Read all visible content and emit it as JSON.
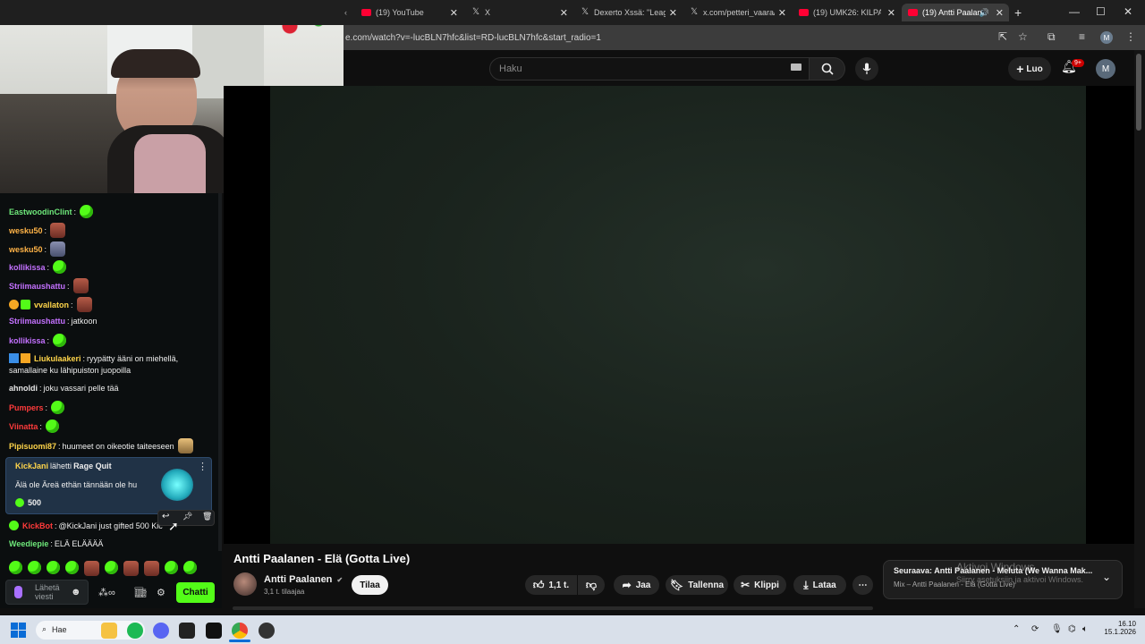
{
  "browser": {
    "tabs": [
      {
        "label": "(19) YouTube",
        "icon": "youtube-icon"
      },
      {
        "label": "X",
        "icon": "x-icon"
      },
      {
        "label": "Dexerto Xssä: \"Leagu",
        "icon": "x-icon"
      },
      {
        "label": "x.com/petteri_vaara/",
        "icon": "x-icon"
      },
      {
        "label": "(19) UMK26: KILPAILI",
        "icon": "youtube-icon"
      },
      {
        "label": "(19) Antti Paalane",
        "icon": "youtube-icon",
        "active": true
      }
    ],
    "url": "e.com/watch?v=-lucBLN7hfc&list=RD-lucBLN7hfc&start_radio=1",
    "profile_letter": "M"
  },
  "youtube": {
    "search_placeholder": "Haku",
    "create_label": "Luo",
    "notifications_badge": "9+",
    "avatar_letter": "M",
    "video_title": "Antti Paalanen - Elä (Gotta Live)",
    "channel_name": "Antti Paalanen",
    "subscribers": "3,1 t. tilaajaa",
    "subscribe_label": "Tilaa",
    "like_count": "1,1 t.",
    "share_label": "Jaa",
    "save_label": "Tallenna",
    "clip_label": "Klippi",
    "download_label": "Lataa",
    "next_label": "Seuraava: Antti Paalanen - Meluta (We Wanna Mak...",
    "next_sub": "Mix – Antti Paalanen - Elä (Gotta Live)",
    "watermark_title": "Aktivoi Windows",
    "watermark_sub": "Siirry asetuksiin ja aktivoi Windows."
  },
  "chat": {
    "messages": [
      {
        "user": "EastwoodinClint",
        "color": "#6ee87a",
        "text": "",
        "emote": "green"
      },
      {
        "user": "wesku50",
        "color": "#ffb347",
        "text": "",
        "emote": "face"
      },
      {
        "user": "wesku50",
        "color": "#ffb347",
        "text": "",
        "emote": "person"
      },
      {
        "user": "kollikissa",
        "color": "#c471ff",
        "text": "",
        "emote": "green"
      },
      {
        "user": "Striimaushattu",
        "color": "#c471ff",
        "text": "",
        "emote": "face"
      },
      {
        "user": "vvallaton",
        "color": "#ffd54a",
        "text": "",
        "emote": "face"
      },
      {
        "user": "Striimaushattu",
        "color": "#c471ff",
        "text": "jatkoon",
        "emote": ""
      },
      {
        "user": "kollikissa",
        "color": "#c471ff",
        "text": "",
        "emote": "green"
      },
      {
        "user": "Liukulaakeri",
        "color": "#ffd54a",
        "text": "ryypätty ääni on miehellä,",
        "emote": ""
      },
      {
        "user": "",
        "color": "#efefef",
        "text": "samallaine ku lähipuiston juopoilla",
        "emote": ""
      },
      {
        "user": "ahnoldi",
        "color": "#e6e6e6",
        "text": "joku vassari pelle tää",
        "emote": ""
      },
      {
        "user": "Pumpers",
        "color": "#ff3b3b",
        "text": "",
        "emote": "green"
      },
      {
        "user": "Viinatta",
        "color": "#ff3b3b",
        "text": "",
        "emote": "green"
      },
      {
        "user": "Pipisuomi87",
        "color": "#ffd54a",
        "text": "huumeet on oikeotie taiteeseen",
        "emote": "face"
      }
    ],
    "gift": {
      "user": "KickJani",
      "action": "lähetti",
      "item": "Rage Quit",
      "message": "Älä ole Äreä ethän tännään ole hu",
      "amount": "500"
    },
    "after": [
      {
        "user": "KickBot",
        "color": "#ff3b3b",
        "text": "@KickJani just gifted 500 Kic"
      },
      {
        "user": "Weediepie",
        "color": "#6ee87a",
        "text": "ELÄ ELÄÄÄÄ"
      }
    ],
    "input_placeholder": "Lähetä viesti",
    "chat_button": "Chatti"
  },
  "taskbar": {
    "search_label": "Hae",
    "time": "16.10",
    "date": "15.1.2026"
  }
}
